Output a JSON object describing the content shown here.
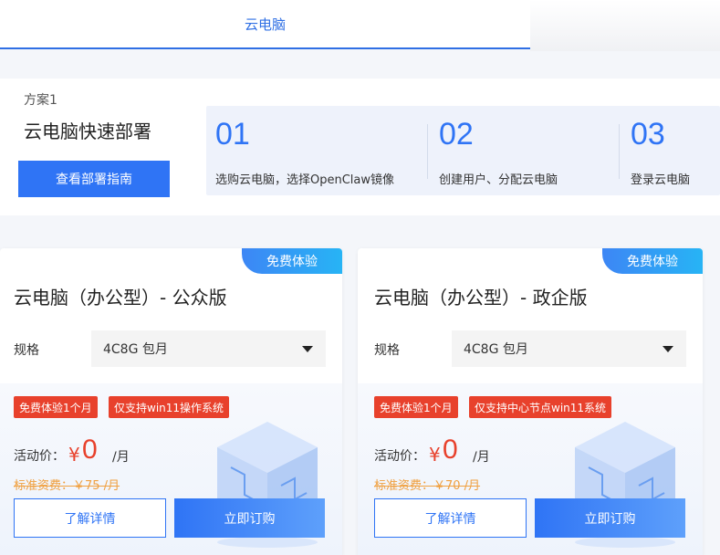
{
  "tabs": {
    "active_label": "云电脑"
  },
  "plan": {
    "name": "方案1",
    "title": "云电脑快速部署",
    "guide_button": "查看部署指南",
    "steps": [
      {
        "num": "01",
        "text": "选购云电脑，选择OpenClaw镜像"
      },
      {
        "num": "02",
        "text": "创建用户、分配云电脑"
      },
      {
        "num": "03",
        "text": "登录云电脑"
      }
    ]
  },
  "products": [
    {
      "badge": "免费体验",
      "title": "云电脑（办公型）- 公众版",
      "spec_label": "规格",
      "spec_value": "4C8G 包月",
      "tags": [
        "免费体验1个月",
        "仅支持win11操作系统"
      ],
      "price_label": "活动价：",
      "currency": "¥",
      "price": "0",
      "unit": "/月",
      "standard_price": "标准资费：￥75 /月",
      "detail_button": "了解详情",
      "order_button": "立即订购"
    },
    {
      "badge": "免费体验",
      "title": "云电脑（办公型）- 政企版",
      "spec_label": "规格",
      "spec_value": "4C8G 包月",
      "tags": [
        "免费体验1个月",
        "仅支持中心节点win11系统"
      ],
      "price_label": "活动价：",
      "currency": "¥",
      "price": "0",
      "unit": "/月",
      "standard_price": "标准资费：￥70 /月",
      "detail_button": "了解详情",
      "order_button": "立即订购"
    }
  ],
  "colors": {
    "accent": "#2f74f5",
    "tag_red": "#e8412c",
    "std_price": "#f0a040"
  }
}
